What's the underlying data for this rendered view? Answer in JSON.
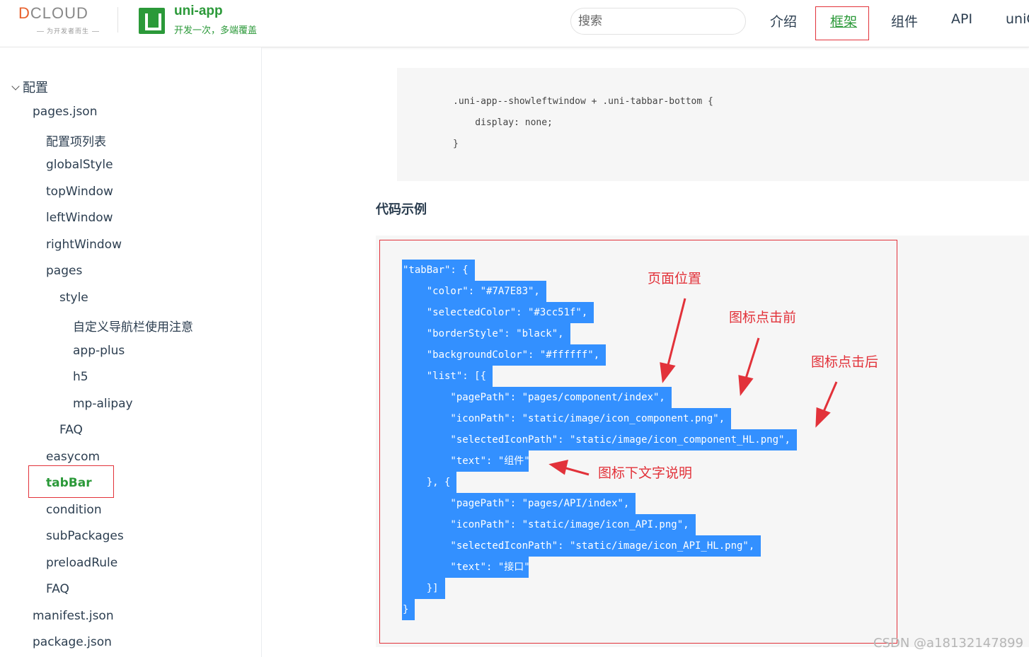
{
  "header": {
    "dcloud_logo": "DCLOUD",
    "dcloud_tagline": "为开发者而生",
    "app_title": "uni-app",
    "app_slogan": "开发一次，多端覆盖",
    "search_placeholder": "搜索",
    "nav": [
      "介绍",
      "框架",
      "组件",
      "API",
      "uniCl"
    ],
    "active_nav": "框架"
  },
  "sidebar": {
    "section": "配置",
    "items": [
      {
        "label": "pages.json",
        "level": 1
      },
      {
        "label": "配置项列表",
        "level": 2
      },
      {
        "label": "globalStyle",
        "level": 2
      },
      {
        "label": "topWindow",
        "level": 2
      },
      {
        "label": "leftWindow",
        "level": 2
      },
      {
        "label": "rightWindow",
        "level": 2
      },
      {
        "label": "pages",
        "level": 2
      },
      {
        "label": "style",
        "level": 3
      },
      {
        "label": "自定义导航栏使用注意",
        "level": 4
      },
      {
        "label": "app-plus",
        "level": 4
      },
      {
        "label": "h5",
        "level": 4
      },
      {
        "label": "mp-alipay",
        "level": 4
      },
      {
        "label": "FAQ",
        "level": 3
      },
      {
        "label": "easycom",
        "level": 2
      },
      {
        "label": "tabBar",
        "level": 2,
        "active": true
      },
      {
        "label": "condition",
        "level": 2
      },
      {
        "label": "subPackages",
        "level": 2
      },
      {
        "label": "preloadRule",
        "level": 2
      },
      {
        "label": "FAQ",
        "level": 2
      },
      {
        "label": "manifest.json",
        "level": 1
      },
      {
        "label": "package.json",
        "level": 1
      }
    ]
  },
  "content": {
    "css_code": [
      ".uni-app--showleftwindow + .uni-tabbar-bottom {",
      "    display: none;",
      "}"
    ],
    "section_title": "代码示例",
    "example_code": [
      "\"tabBar\": {",
      "    \"color\": \"#7A7E83\",",
      "    \"selectedColor\": \"#3cc51f\",",
      "    \"borderStyle\": \"black\",",
      "    \"backgroundColor\": \"#ffffff\",",
      "    \"list\": [{",
      "        \"pagePath\": \"pages/component/index\",",
      "        \"iconPath\": \"static/image/icon_component.png\",",
      "        \"selectedIconPath\": \"static/image/icon_component_HL.png\",",
      "        \"text\": \"组件\"",
      "    }, {",
      "        \"pagePath\": \"pages/API/index\",",
      "        \"iconPath\": \"static/image/icon_API.png\",",
      "        \"selectedIconPath\": \"static/image/icon_API_HL.png\",",
      "        \"text\": \"接口\"",
      "    }]",
      "}"
    ],
    "annotations": [
      "页面位置",
      "图标点击前",
      "图标点击后",
      "图标下文字说明"
    ]
  },
  "watermark": "CSDN @a18132147899",
  "colors": {
    "brand_green": "#2b9939",
    "annotation_red": "#e2323a",
    "selection_blue": "#3390ff",
    "code_background": "#f6f6f6"
  }
}
